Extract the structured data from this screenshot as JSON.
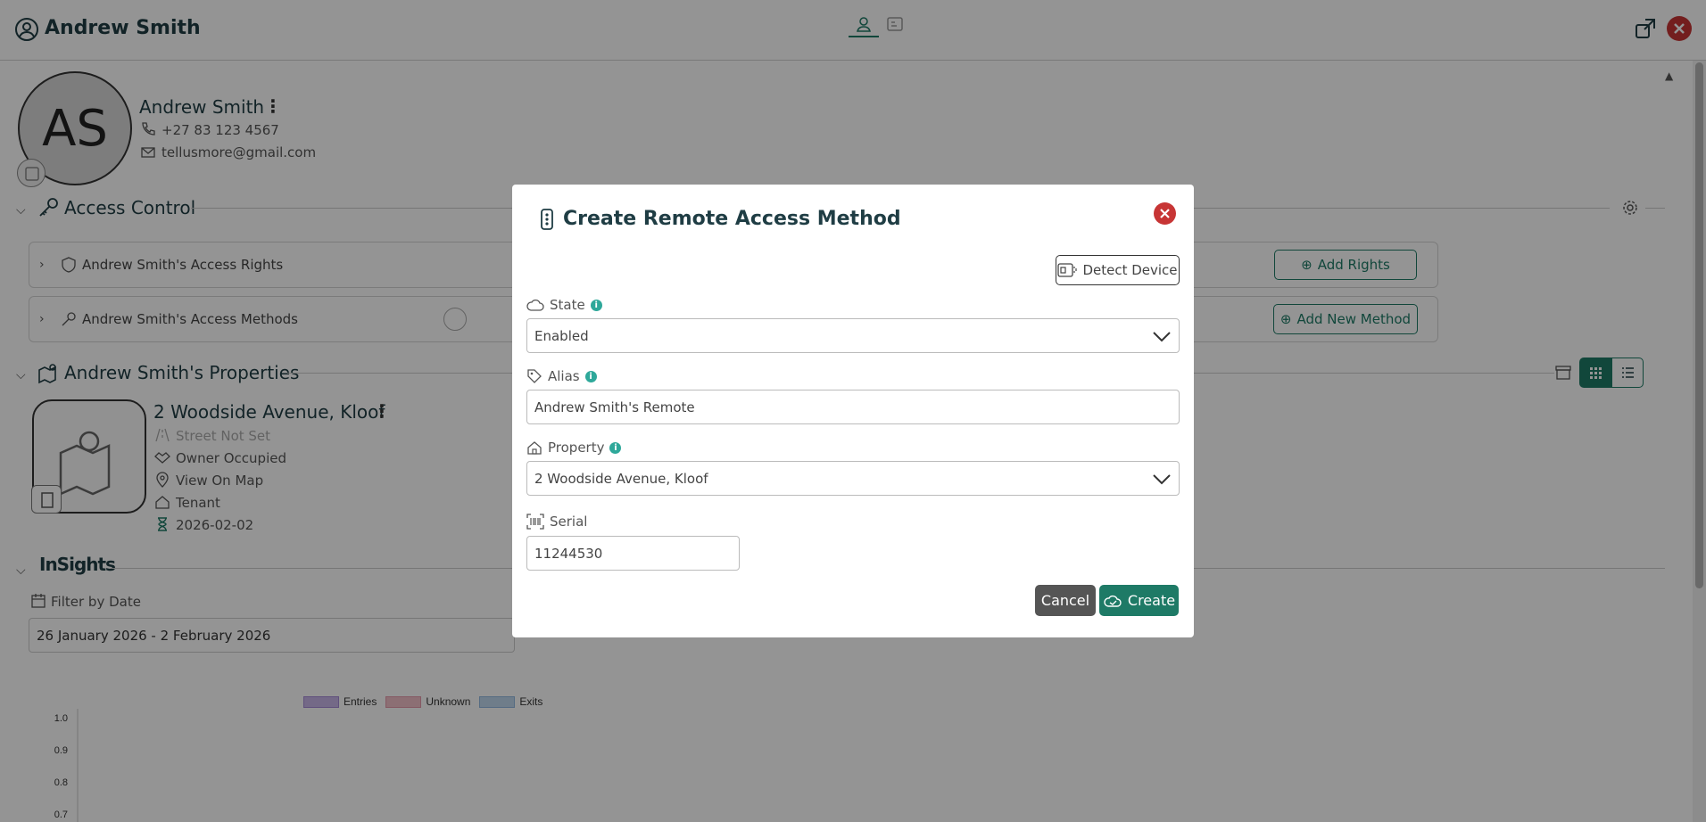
{
  "header": {
    "title": "Andrew Smith"
  },
  "profile": {
    "initials": "AS",
    "name": "Andrew Smith",
    "phone": "+27 83 123 4567",
    "email": "tellusmore@gmail.com"
  },
  "access_control": {
    "title": "Access Control",
    "rights_label": "Andrew Smith's Access Rights",
    "rights_button": "Add Rights",
    "methods_label": "Andrew Smith's Access Methods",
    "methods_button": "Add New Method"
  },
  "properties": {
    "title": "Andrew Smith's Properties",
    "card": {
      "title": "2 Woodside Avenue, Kloof",
      "street": "Street Not Set",
      "occupancy": "Owner Occupied",
      "map_link": "View On Map",
      "role": "Tenant",
      "date": "2026-02-02"
    }
  },
  "insights": {
    "logo": "InSights",
    "filter_label": "Filter by Date",
    "date_range": "26 January 2026 - 2 February 2026"
  },
  "chart_data": {
    "type": "line",
    "series": [
      {
        "name": "Entries",
        "color": "#c9b6e8",
        "values": []
      },
      {
        "name": "Unknown",
        "color": "#f2bfc9",
        "values": []
      },
      {
        "name": "Exits",
        "color": "#bfd7ee",
        "values": []
      }
    ],
    "y_ticks": [
      "1.0",
      "0.9",
      "0.8",
      "0.7"
    ],
    "ylim": [
      0.7,
      1.0
    ],
    "legend": "top"
  },
  "modal": {
    "title": "Create Remote Access Method",
    "detect_button": "Detect Device",
    "state_label": "State",
    "state_value": "Enabled",
    "alias_label": "Alias",
    "alias_value": "Andrew Smith's Remote",
    "property_label": "Property",
    "property_value": "2 Woodside Avenue, Kloof",
    "serial_label": "Serial",
    "serial_value": "11244530",
    "cancel_button": "Cancel",
    "create_button": "Create"
  },
  "colors": {
    "accent": "#1e7a66",
    "danger": "#c73535",
    "info": "#2ea89a"
  }
}
